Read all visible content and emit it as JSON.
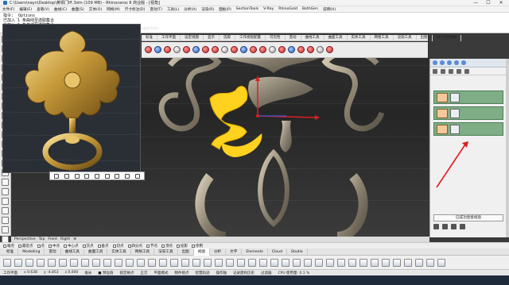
{
  "window": {
    "title": "C:\\Users\\nayn\\Desktop\\黄铜门环.3dm (109 MB) - Rhinoceros 6 商业版 - [视角]",
    "controls": [
      "—",
      "☐",
      "✕"
    ]
  },
  "menubar": {
    "items": [
      "文件(F)",
      "编辑(E)",
      "查看(V)",
      "曲线(C)",
      "曲面(S)",
      "实体(O)",
      "网格(M)",
      "尺寸标注(D)",
      "变动(T)",
      "工具(L)",
      "分析(A)",
      "渲染(R)",
      "面板(P)",
      "SectionTools",
      "V-Ray",
      "RhinoGold",
      "BothGen",
      "说明(H)"
    ]
  },
  "command": {
    "lines": [
      "指令: _Options",
      "已加入 1 条曲线至选取集合",
      "已加入 1 条曲线至选取集合",
      "指令:"
    ]
  },
  "toolbar_tabs": [
    "标准",
    "工作平面",
    "设定视图",
    "显示",
    "选取",
    "工作视窗配置",
    "可见性",
    "变动",
    "曲线工具",
    "曲面工具",
    "实体工具",
    "网格工具",
    "渲染工具",
    "出图",
    "V6 的新功能"
  ],
  "viewport": {
    "label": "Perspective"
  },
  "layers_panel": {
    "footer_label": "已成功连接视窗",
    "row_count": 3
  },
  "view_tabs": [
    "Perspective",
    "Top",
    "Front",
    "Right",
    "⊕"
  ],
  "osnap": {
    "items": [
      "端点",
      "最近点",
      "点",
      "中点",
      "中心点",
      "交点",
      "垂点",
      "切点",
      "四分点",
      "节点",
      "顶点",
      "投影",
      "停用"
    ]
  },
  "bottom_tabs": {
    "items": [
      "标准",
      "Modelling",
      "变动",
      "曲线工具",
      "曲面工具",
      "实体工具",
      "网格工具",
      "渲染工具",
      "出图",
      "视图",
      "分析",
      "文字",
      "Elements",
      "Cloud",
      "Studio"
    ],
    "active_index": 9
  },
  "statusbar": {
    "items": [
      "工作平面",
      "x 0.638",
      "y -4.853",
      "z 0.000",
      "毫米",
      "■ 预设值",
      "锁定格点",
      "正交",
      "平面模式",
      "物件锁点",
      "智慧轨迹",
      "操作轴",
      "记录建构历史",
      "过滤器",
      "CPU 使用量: 0.1 %"
    ]
  },
  "colors": {
    "accent_red": "#e01e1e",
    "highlight_yellow": "#ffd21f",
    "layer_green": "#7fae86",
    "viewport_bg": "#2f2f2f"
  }
}
